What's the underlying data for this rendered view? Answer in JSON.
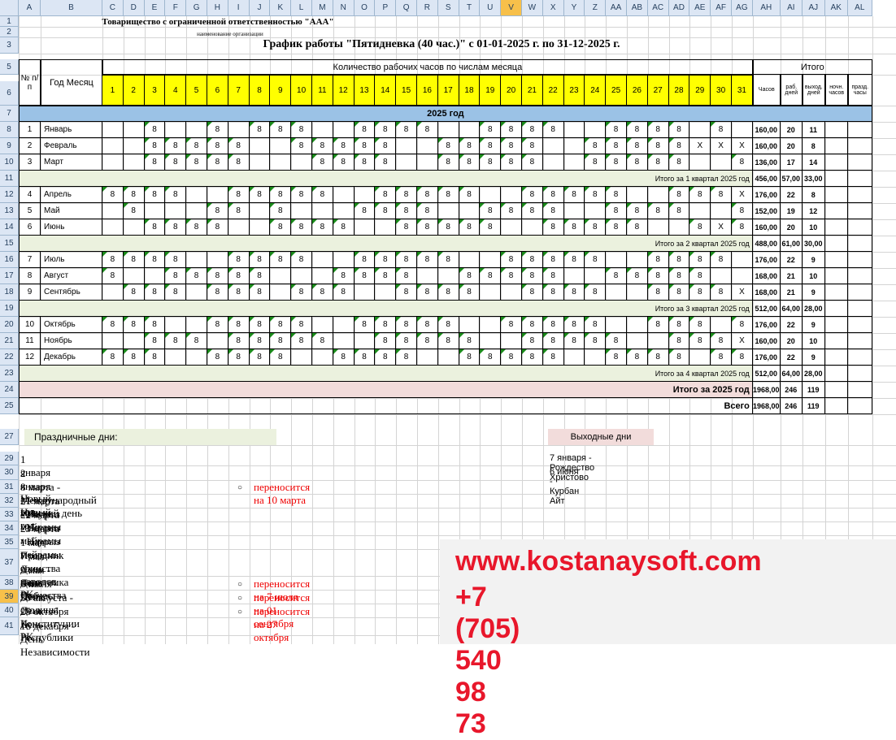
{
  "columns": [
    "A",
    "B",
    "C",
    "D",
    "E",
    "F",
    "G",
    "H",
    "I",
    "J",
    "K",
    "L",
    "M",
    "N",
    "O",
    "P",
    "Q",
    "R",
    "S",
    "T",
    "U",
    "V",
    "W",
    "X",
    "Y",
    "Z",
    "AA",
    "AB",
    "AC",
    "AD",
    "AE",
    "AF",
    "AG",
    "AH",
    "AI",
    "AJ",
    "AK",
    "AL"
  ],
  "selected_column": "V",
  "rows": [
    "1",
    "2",
    "3",
    "5",
    "6",
    "7",
    "8",
    "9",
    "10",
    "11",
    "12",
    "13",
    "14",
    "15",
    "16",
    "17",
    "18",
    "19",
    "20",
    "21",
    "22",
    "23",
    "24",
    "25",
    "27",
    "29",
    "30",
    "31",
    "32",
    "33",
    "34",
    "35",
    "37",
    "38",
    "39",
    "40",
    "41"
  ],
  "selected_row": "39",
  "org_name": "Товарищество с ограниченной ответственностью \"ААА\"",
  "org_caption": "наименование организации",
  "title": "График работы \"Пятидневка (40 час.)\" с 01-01-2025 г. по 31-12-2025 г.",
  "header": {
    "num": "№ п/п",
    "year_month": "Год Месяц",
    "hours_by_day": "Количество рабочих часов по числам месяца",
    "total": "Итого",
    "hours": "Часов",
    "work_days": "раб. дней",
    "off_days": "выход. дней",
    "night_hours": "ночн. часов",
    "holiday_hours": "празд. часы"
  },
  "days": [
    "1",
    "2",
    "3",
    "4",
    "5",
    "6",
    "7",
    "8",
    "9",
    "10",
    "11",
    "12",
    "13",
    "14",
    "15",
    "16",
    "17",
    "18",
    "19",
    "20",
    "21",
    "22",
    "23",
    "24",
    "25",
    "26",
    "27",
    "28",
    "29",
    "30",
    "31"
  ],
  "year_label": "2025 год",
  "months": [
    {
      "n": "1",
      "name": "Январь",
      "cells": "__8__8_888__8888__8888__8888_8",
      "hours": "160,00",
      "work": "20",
      "off": "11"
    },
    {
      "n": "2",
      "name": "Февраль",
      "cells": "__88888__88888__88888__88888xxx",
      "hours": "160,00",
      "work": "20",
      "off": "8"
    },
    {
      "n": "3",
      "name": "Март",
      "cells": "__88888___8888__88888__88888__8",
      "hours": "136,00",
      "work": "17",
      "off": "14"
    },
    {
      "n": "4",
      "name": "Апрель",
      "cells": "8888__88888__88888__88888__888x",
      "hours": "176,00",
      "work": "22",
      "off": "8"
    },
    {
      "n": "5",
      "name": "Май",
      "cells": "_8___88_8___8888__8888__8888__8",
      "hours": "152,00",
      "work": "19",
      "off": "12"
    },
    {
      "n": "6",
      "name": "Июнь",
      "cells": "__8888__8888__88888__88888__8x8",
      "hours": "160,00",
      "work": "20",
      "off": "10"
    },
    {
      "n": "7",
      "name": "Июль",
      "cells": "8888__8888__88888__88888__8888",
      "hours": "176,00",
      "work": "22",
      "off": "9"
    },
    {
      "n": "8",
      "name": "Август",
      "cells": "8__88888___8888__88888__88888__",
      "hours": "168,00",
      "work": "21",
      "off": "10"
    },
    {
      "n": "9",
      "name": "Сентябрь",
      "cells": "_888_888_888__8888__8888__8888x",
      "hours": "168,00",
      "work": "21",
      "off": "9"
    },
    {
      "n": "10",
      "name": "Октябрь",
      "cells": "888__88888__88888__88888__888_8",
      "hours": "176,00",
      "work": "22",
      "off": "9"
    },
    {
      "n": "11",
      "name": "Ноябрь",
      "cells": "__888_88888__88888__88888__888x",
      "hours": "160,00",
      "work": "20",
      "off": "10"
    },
    {
      "n": "12",
      "name": "Декабрь",
      "cells": "888__8888__8888__88888__8888_88",
      "hours": "176,00",
      "work": "22",
      "off": "9"
    }
  ],
  "quarters": [
    {
      "label": "Итого за 1 квартал 2025 год",
      "hours": "456,00",
      "work": "57,00",
      "off": "33,00"
    },
    {
      "label": "Итого за 2 квартал 2025 год",
      "hours": "488,00",
      "work": "61,00",
      "off": "30,00"
    },
    {
      "label": "Итого за 3 квартал 2025 год",
      "hours": "512,00",
      "work": "64,00",
      "off": "28,00"
    },
    {
      "label": "Итого за 4 квартал 2025 год",
      "hours": "512,00",
      "work": "64,00",
      "off": "28,00"
    }
  ],
  "year_total": {
    "label": "Итого за 2025 год",
    "hours": "1968,00",
    "work": "246",
    "off": "119"
  },
  "grand_total": {
    "label": "Всего",
    "hours": "1968,00",
    "work": "246",
    "off": "119"
  },
  "holidays_title": "Праздничные дни:",
  "weekends_title": "Выходные дни",
  "holidays": [
    {
      "text": "1 января - Новый год",
      "moved": ""
    },
    {
      "text": "2 января - Новый год",
      "moved": ""
    },
    {
      "text": "8 марта - Международный женский день",
      "moved": "переносится на 10 марта"
    },
    {
      "text": "21 марта - Наурыз мейрамы",
      "moved": ""
    },
    {
      "text": "22 марта - Наурыз мейрамы",
      "moved": ""
    },
    {
      "text": "23 марта - Наурыз мейрамы",
      "moved": ""
    },
    {
      "text": "1 мая - Праздник единства народов РК",
      "moved": ""
    },
    {
      "text": "7 мая - День защитника Отечества",
      "moved": ""
    },
    {
      "text": "9 мая - День Победы",
      "moved": ""
    },
    {
      "text": "6 июля - День столицы",
      "moved": "переносится на 7 июля"
    },
    {
      "text": "30 августа - День Конституции РК",
      "moved": "переносится на 01 сентября"
    },
    {
      "text": "25 октября День Республики",
      "moved": "переносится на 27 октября"
    },
    {
      "text": "16 декабря - День Независимости",
      "moved": ""
    }
  ],
  "bullet": "○",
  "weekends": [
    "7 января - Рождество Христово",
    "6 июня - Курбан Айт"
  ],
  "ad": {
    "site": "www.kostanaysoft.com",
    "phone": "+7 (705) 540 98 73"
  }
}
